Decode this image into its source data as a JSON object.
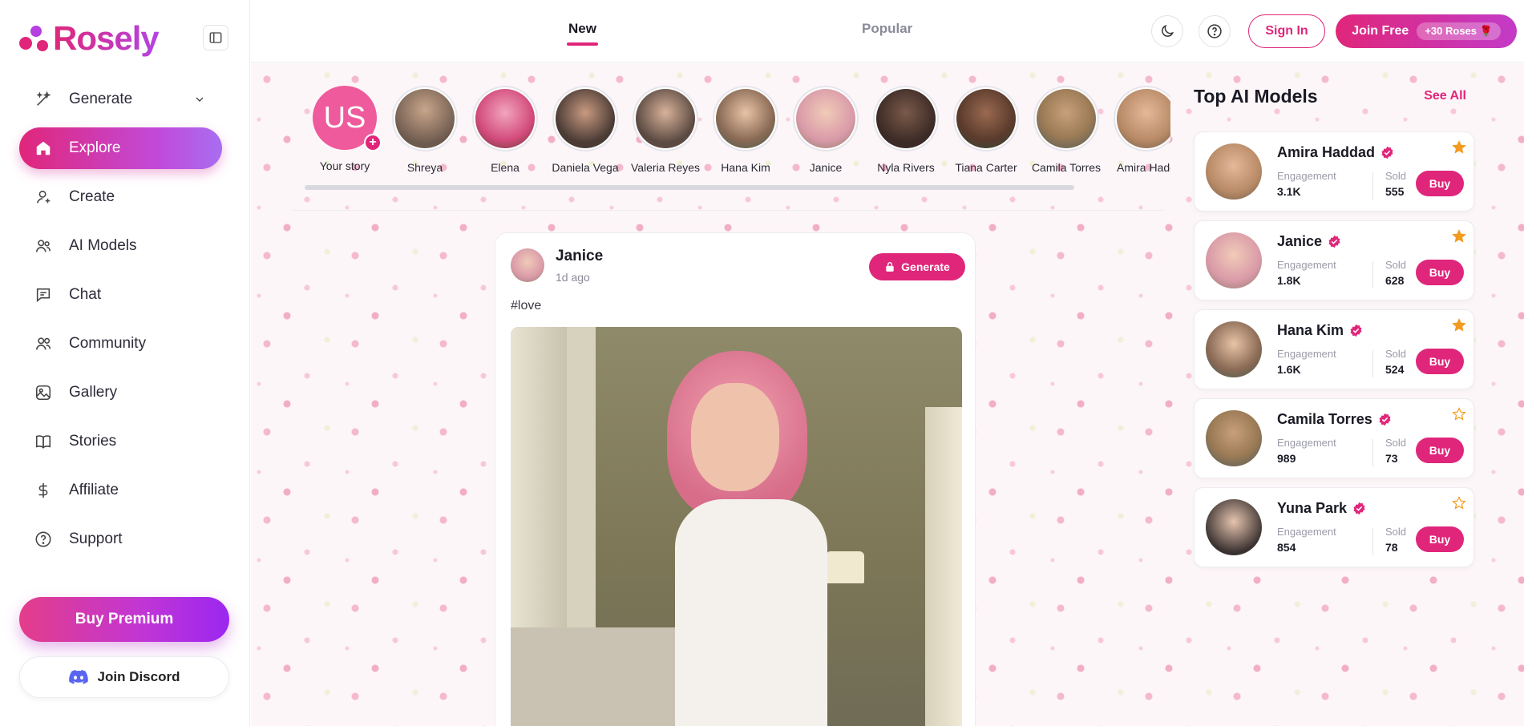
{
  "brand": {
    "name": "Rosely"
  },
  "sidebar": {
    "items": [
      {
        "label": "Generate",
        "icon": "wand-icon"
      },
      {
        "label": "Explore",
        "icon": "home-icon"
      },
      {
        "label": "Create",
        "icon": "create-icon"
      },
      {
        "label": "AI Models",
        "icon": "users-icon"
      },
      {
        "label": "Chat",
        "icon": "chat-icon"
      },
      {
        "label": "Community",
        "icon": "community-icon"
      },
      {
        "label": "Gallery",
        "icon": "gallery-icon"
      },
      {
        "label": "Stories",
        "icon": "book-icon"
      },
      {
        "label": "Affiliate",
        "icon": "dollar-icon"
      },
      {
        "label": "Support",
        "icon": "help-icon"
      }
    ],
    "buy_premium": "Buy Premium",
    "join_discord": "Join Discord"
  },
  "header": {
    "tabs": [
      {
        "label": "New",
        "active": true
      },
      {
        "label": "Popular",
        "active": false
      }
    ],
    "sign_in": "Sign In",
    "join_free": "Join Free",
    "join_free_badge": "+30 Roses 🌹"
  },
  "stories": {
    "your_story": {
      "initials": "US",
      "label": "Your story"
    },
    "items": [
      {
        "name": "Shreya",
        "color": "#6d5a4e"
      },
      {
        "name": "Elena",
        "color": "#d24a7a"
      },
      {
        "name": "Daniela Vega",
        "color": "#4a3b35"
      },
      {
        "name": "Valeria Reyes",
        "color": "#5b4a42"
      },
      {
        "name": "Hana Kim",
        "color": "#8a6a55"
      },
      {
        "name": "Janice",
        "color": "#d99aa8"
      },
      {
        "name": "Nyla Rivers",
        "color": "#3b2a25"
      },
      {
        "name": "Tiana Carter",
        "color": "#5a3a2c"
      },
      {
        "name": "Camila Torres",
        "color": "#9a7a55"
      },
      {
        "name": "Amira Hadd",
        "color": "#b88a66"
      }
    ]
  },
  "post": {
    "author": "Janice",
    "time": "1d ago",
    "generate_label": "Generate",
    "tag": "#love"
  },
  "top_models": {
    "title": "Top AI Models",
    "see_all": "See All",
    "engagement_label": "Engagement",
    "sold_label": "Sold",
    "buy_label": "Buy",
    "models": [
      {
        "name": "Amira Haddad",
        "engagement": "3.1K",
        "sold": "555",
        "starred": true,
        "color": "#b88a66"
      },
      {
        "name": "Janice",
        "engagement": "1.8K",
        "sold": "628",
        "starred": true,
        "color": "#d99aa8"
      },
      {
        "name": "Hana Kim",
        "engagement": "1.6K",
        "sold": "524",
        "starred": true,
        "color": "#8a6a55"
      },
      {
        "name": "Camila Torres",
        "engagement": "989",
        "sold": "73",
        "starred": false,
        "color": "#9a7a55"
      },
      {
        "name": "Yuna Park",
        "engagement": "854",
        "sold": "78",
        "starred": false,
        "color": "#3a3230"
      }
    ]
  },
  "colors": {
    "accent": "#e0267a",
    "accent_purple": "#b344e2",
    "star": "#f29b1f"
  }
}
